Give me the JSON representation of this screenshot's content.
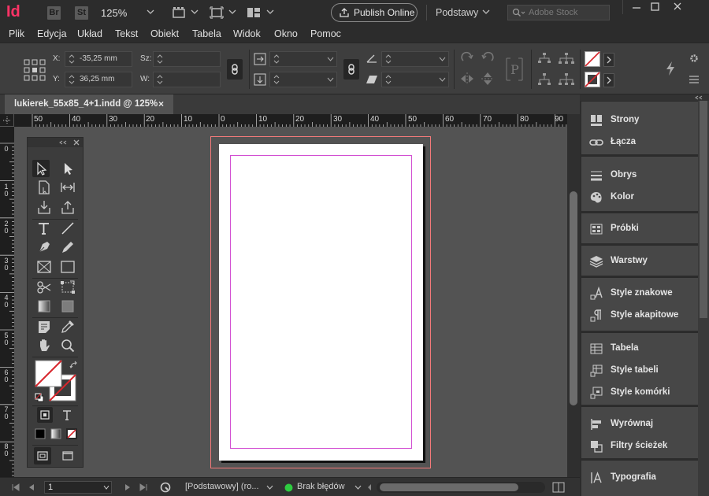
{
  "app": {
    "logo": "Id",
    "bridge": "Br",
    "stock_app": "St",
    "zoom": "125%",
    "publish_label": "Publish Online",
    "workspace": "Podstawy",
    "search_placeholder": "Adobe Stock"
  },
  "menu": [
    "Plik",
    "Edycja",
    "Układ",
    "Tekst",
    "Obiekt",
    "Tabela",
    "Widok",
    "Okno",
    "Pomoc"
  ],
  "control": {
    "x_label": "X:",
    "x_value": "-35,25 mm",
    "y_label": "Y:",
    "y_value": "36,25 mm",
    "w_label": "Sz:",
    "h_label": "W:"
  },
  "document": {
    "tab_title": "lukierek_55x85_4+1.indd @ 125%",
    "close": "×"
  },
  "ruler": {
    "h_ticks": [
      "50",
      "40",
      "30",
      "20",
      "10",
      "0",
      "10",
      "20",
      "30",
      "40",
      "50",
      "60",
      "70",
      "80",
      "90"
    ],
    "v_ticks": [
      "0",
      "10",
      "20",
      "30",
      "40",
      "50",
      "60",
      "70",
      "80"
    ]
  },
  "status": {
    "page": "1",
    "master": "[Podstawowy] (ro...",
    "preflight": "Brak błędów",
    "preflight_color": "#2ecc40"
  },
  "panels": [
    {
      "group": 1,
      "items": [
        {
          "label": "Strony",
          "icon": "pages-icon"
        },
        {
          "label": "Łącza",
          "icon": "links-icon"
        }
      ]
    },
    {
      "group": 2,
      "items": [
        {
          "label": "Obrys",
          "icon": "stroke-icon"
        },
        {
          "label": "Kolor",
          "icon": "color-palette-icon"
        }
      ]
    },
    {
      "group": 3,
      "items": [
        {
          "label": "Próbki",
          "icon": "swatches-icon"
        }
      ]
    },
    {
      "group": 4,
      "items": [
        {
          "label": "Warstwy",
          "icon": "layers-icon"
        }
      ]
    },
    {
      "group": 5,
      "items": [
        {
          "label": "Style znakowe",
          "icon": "character-styles-icon"
        },
        {
          "label": "Style akapitowe",
          "icon": "paragraph-styles-icon"
        }
      ]
    },
    {
      "group": 6,
      "items": [
        {
          "label": "Tabela",
          "icon": "table-icon"
        },
        {
          "label": "Style tabeli",
          "icon": "table-styles-icon"
        },
        {
          "label": "Style komórki",
          "icon": "cell-styles-icon"
        }
      ]
    },
    {
      "group": 7,
      "items": [
        {
          "label": "Wyrównaj",
          "icon": "align-icon"
        },
        {
          "label": "Filtry ścieżek",
          "icon": "pathfinder-icon"
        }
      ]
    },
    {
      "group": 8,
      "items": [
        {
          "label": "Typografia",
          "icon": "glyphs-icon"
        }
      ]
    }
  ],
  "colors": {
    "accent": "#ff3366",
    "bleed": "#f47a7a",
    "margin": "#d24fd2"
  }
}
